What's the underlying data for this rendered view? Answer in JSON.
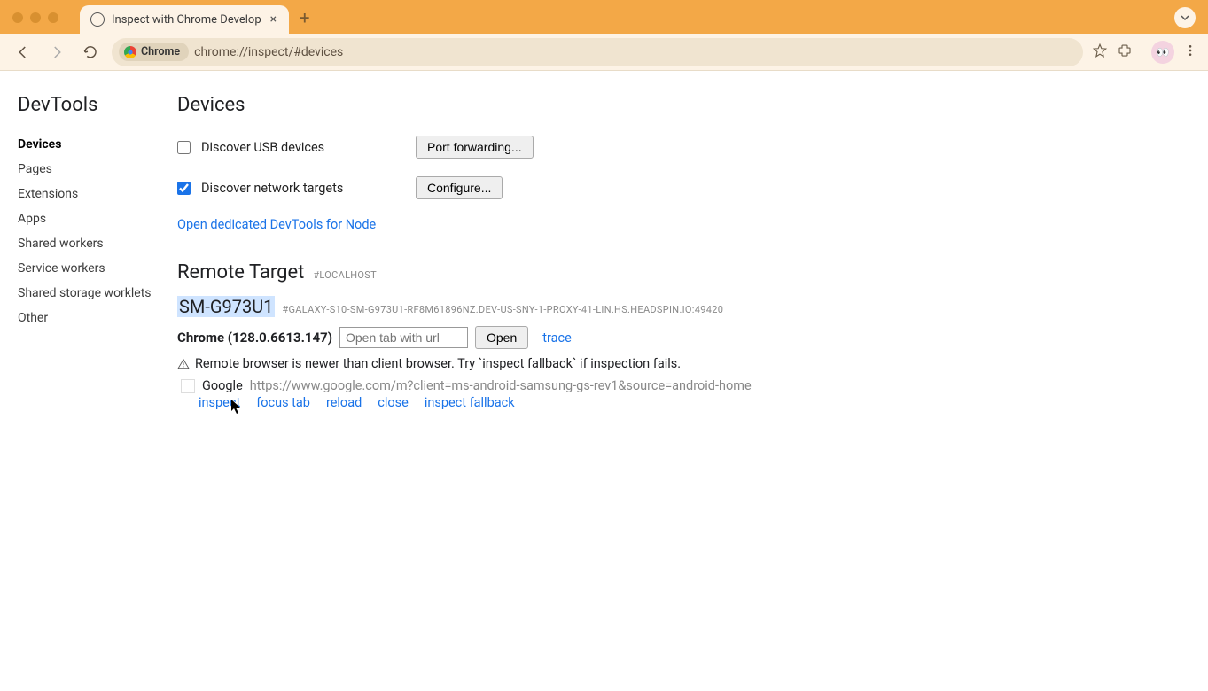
{
  "tab": {
    "title": "Inspect with Chrome Develop"
  },
  "toolbar": {
    "chip_label": "Chrome",
    "url": "chrome://inspect/#devices"
  },
  "sidebar": {
    "title": "DevTools",
    "items": [
      {
        "label": "Devices",
        "active": true
      },
      {
        "label": "Pages",
        "active": false
      },
      {
        "label": "Extensions",
        "active": false
      },
      {
        "label": "Apps",
        "active": false
      },
      {
        "label": "Shared workers",
        "active": false
      },
      {
        "label": "Service workers",
        "active": false
      },
      {
        "label": "Shared storage worklets",
        "active": false
      },
      {
        "label": "Other",
        "active": false
      }
    ]
  },
  "page": {
    "title": "Devices",
    "discover_usb_label": "Discover USB devices",
    "discover_usb_checked": false,
    "port_forwarding_btn": "Port forwarding...",
    "discover_network_label": "Discover network targets",
    "discover_network_checked": true,
    "configure_btn": "Configure...",
    "node_link": "Open dedicated DevTools for Node"
  },
  "remote": {
    "title": "Remote Target",
    "tag": "#LOCALHOST",
    "device_name": "SM-G973U1",
    "device_hash": "#GALAXY-S10-SM-G973U1-RF8M61896NZ.DEV-US-SNY-1-PROXY-41-LIN.HS.HEADSPIN.IO:49420",
    "browser_label": "Chrome (128.0.6613.147)",
    "open_tab_placeholder": "Open tab with url",
    "open_btn": "Open",
    "trace_link": "trace",
    "warning": "Remote browser is newer than client browser. Try `inspect fallback` if inspection fails.",
    "page_title": "Google",
    "page_url": "https://www.google.com/m?client=ms-android-samsung-gs-rev1&source=android-home",
    "actions": {
      "inspect": "inspect",
      "focus_tab": "focus tab",
      "reload": "reload",
      "close": "close",
      "inspect_fallback": "inspect fallback"
    }
  }
}
